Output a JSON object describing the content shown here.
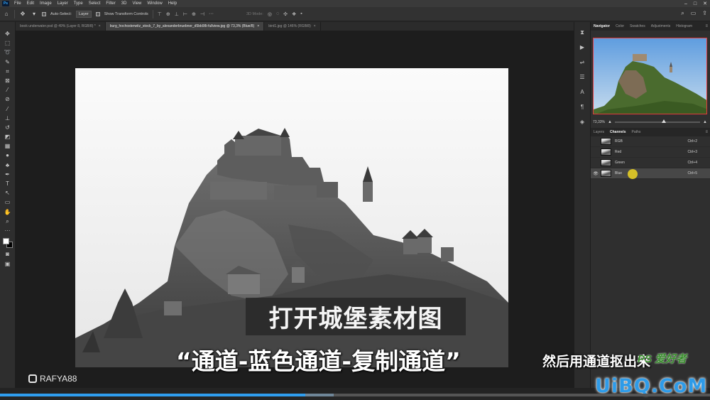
{
  "app": {
    "logo": "Ps",
    "menu": [
      "File",
      "Edit",
      "Image",
      "Layer",
      "Type",
      "Select",
      "Filter",
      "3D",
      "View",
      "Window",
      "Help"
    ]
  },
  "options_bar": {
    "auto_select_label": "Auto-Select:",
    "auto_select_value": "Layer",
    "show_transform_label": "Show Transform Controls",
    "mode_3d": "3D Mode:"
  },
  "tabs": [
    {
      "label": "book underwater.psd @ 49% (Layer 8, RGB/8) *",
      "active": false
    },
    {
      "label": "burg_hochosterwitz_stock_7_by_alexanderbruebner_d5bb98i-fullview.jpg @ 73,3% (Blue/8)",
      "active": true
    },
    {
      "label": "bird1.jpg @ 146% (RGB/8)",
      "active": false
    }
  ],
  "navigator": {
    "tabs": [
      "Navigator",
      "Color",
      "Swatches",
      "Adjustments",
      "Histogram"
    ],
    "zoom": "73,33%"
  },
  "layers_panel": {
    "tabs": [
      "Layers",
      "Channels",
      "Paths"
    ],
    "channels": [
      {
        "name": "RGB",
        "shortcut": "Ctrl+2",
        "visible": false
      },
      {
        "name": "Red",
        "shortcut": "Ctrl+3",
        "visible": false
      },
      {
        "name": "Green",
        "shortcut": "Ctrl+4",
        "visible": false
      },
      {
        "name": "Blue",
        "shortcut": "Ctrl+5",
        "visible": true,
        "selected": true
      }
    ]
  },
  "overlay": {
    "subtitle_1": "打开城堡素材图",
    "subtitle_2": "“通道-蓝色通道-复制通道”",
    "subtitle_3": "然后用通道抠出来",
    "channel_name": "RAFYA88",
    "watermark_main": "UiBQ.CoM",
    "watermark_ps": "PS 爱好者"
  },
  "video": {
    "progress_fraction": 0.43,
    "buffer_fraction": 0.47,
    "accent": "#2f9ef0"
  }
}
